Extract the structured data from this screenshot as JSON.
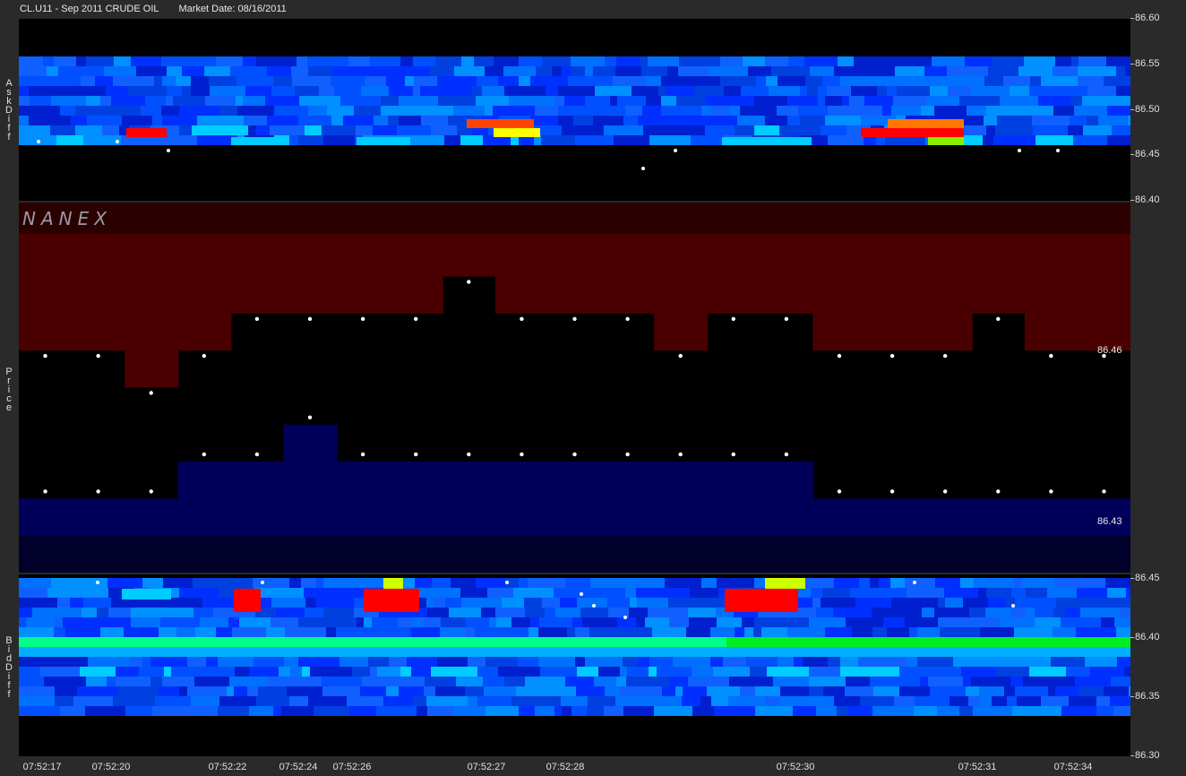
{
  "header": {
    "symbol_title": "CL.U11 - Sep 2011 CRUDE OIL",
    "market_date": "Market Date: 08/16/2011"
  },
  "panels": {
    "ask_label": "AskDiff",
    "price_label": "Price",
    "bid_label": "BidDiff",
    "logo": "NANEX"
  },
  "chart_data": {
    "type": "heatmap",
    "title": "CL.U11 - Sep 2011 CRUDE OIL",
    "x_ticks": [
      "07:52:17",
      "07:52:20",
      "07:52:22",
      "07:52:24",
      "07:52:26",
      "07:52:27",
      "07:52:28",
      "07:52:30",
      "07:52:31",
      "07:52:34"
    ],
    "ask_axis_ticks": [
      "86.60",
      "86.55",
      "86.50",
      "86.45",
      "86.40"
    ],
    "bid_axis_ticks": [
      "86.45",
      "86.40",
      "86.35",
      "86.30"
    ],
    "price_labels": [
      "86.46",
      "86.43"
    ],
    "ask_price": [
      86.46,
      86.46,
      86.45,
      86.46,
      86.47,
      86.47,
      86.47,
      86.47,
      86.48,
      86.47,
      86.47,
      86.47,
      86.46,
      86.47,
      86.47,
      86.46,
      86.46,
      86.46,
      86.47,
      86.46,
      86.46
    ],
    "bid_price": [
      86.42,
      86.42,
      86.42,
      86.43,
      86.43,
      86.44,
      86.43,
      86.43,
      86.43,
      86.43,
      86.43,
      86.43,
      86.43,
      86.43,
      86.43,
      86.42,
      86.42,
      86.42,
      86.42,
      86.42,
      86.42
    ],
    "colors": {
      "ask_fill": "#4a0000",
      "bid_fill": "#00005a",
      "heat_low": "#0000ff",
      "heat_mid": "#00ccff",
      "heat_bid_core": "#00ff88",
      "heat_high": "#ff0000",
      "heat_warn": "#ffff00",
      "marker": "#ffffff"
    }
  }
}
